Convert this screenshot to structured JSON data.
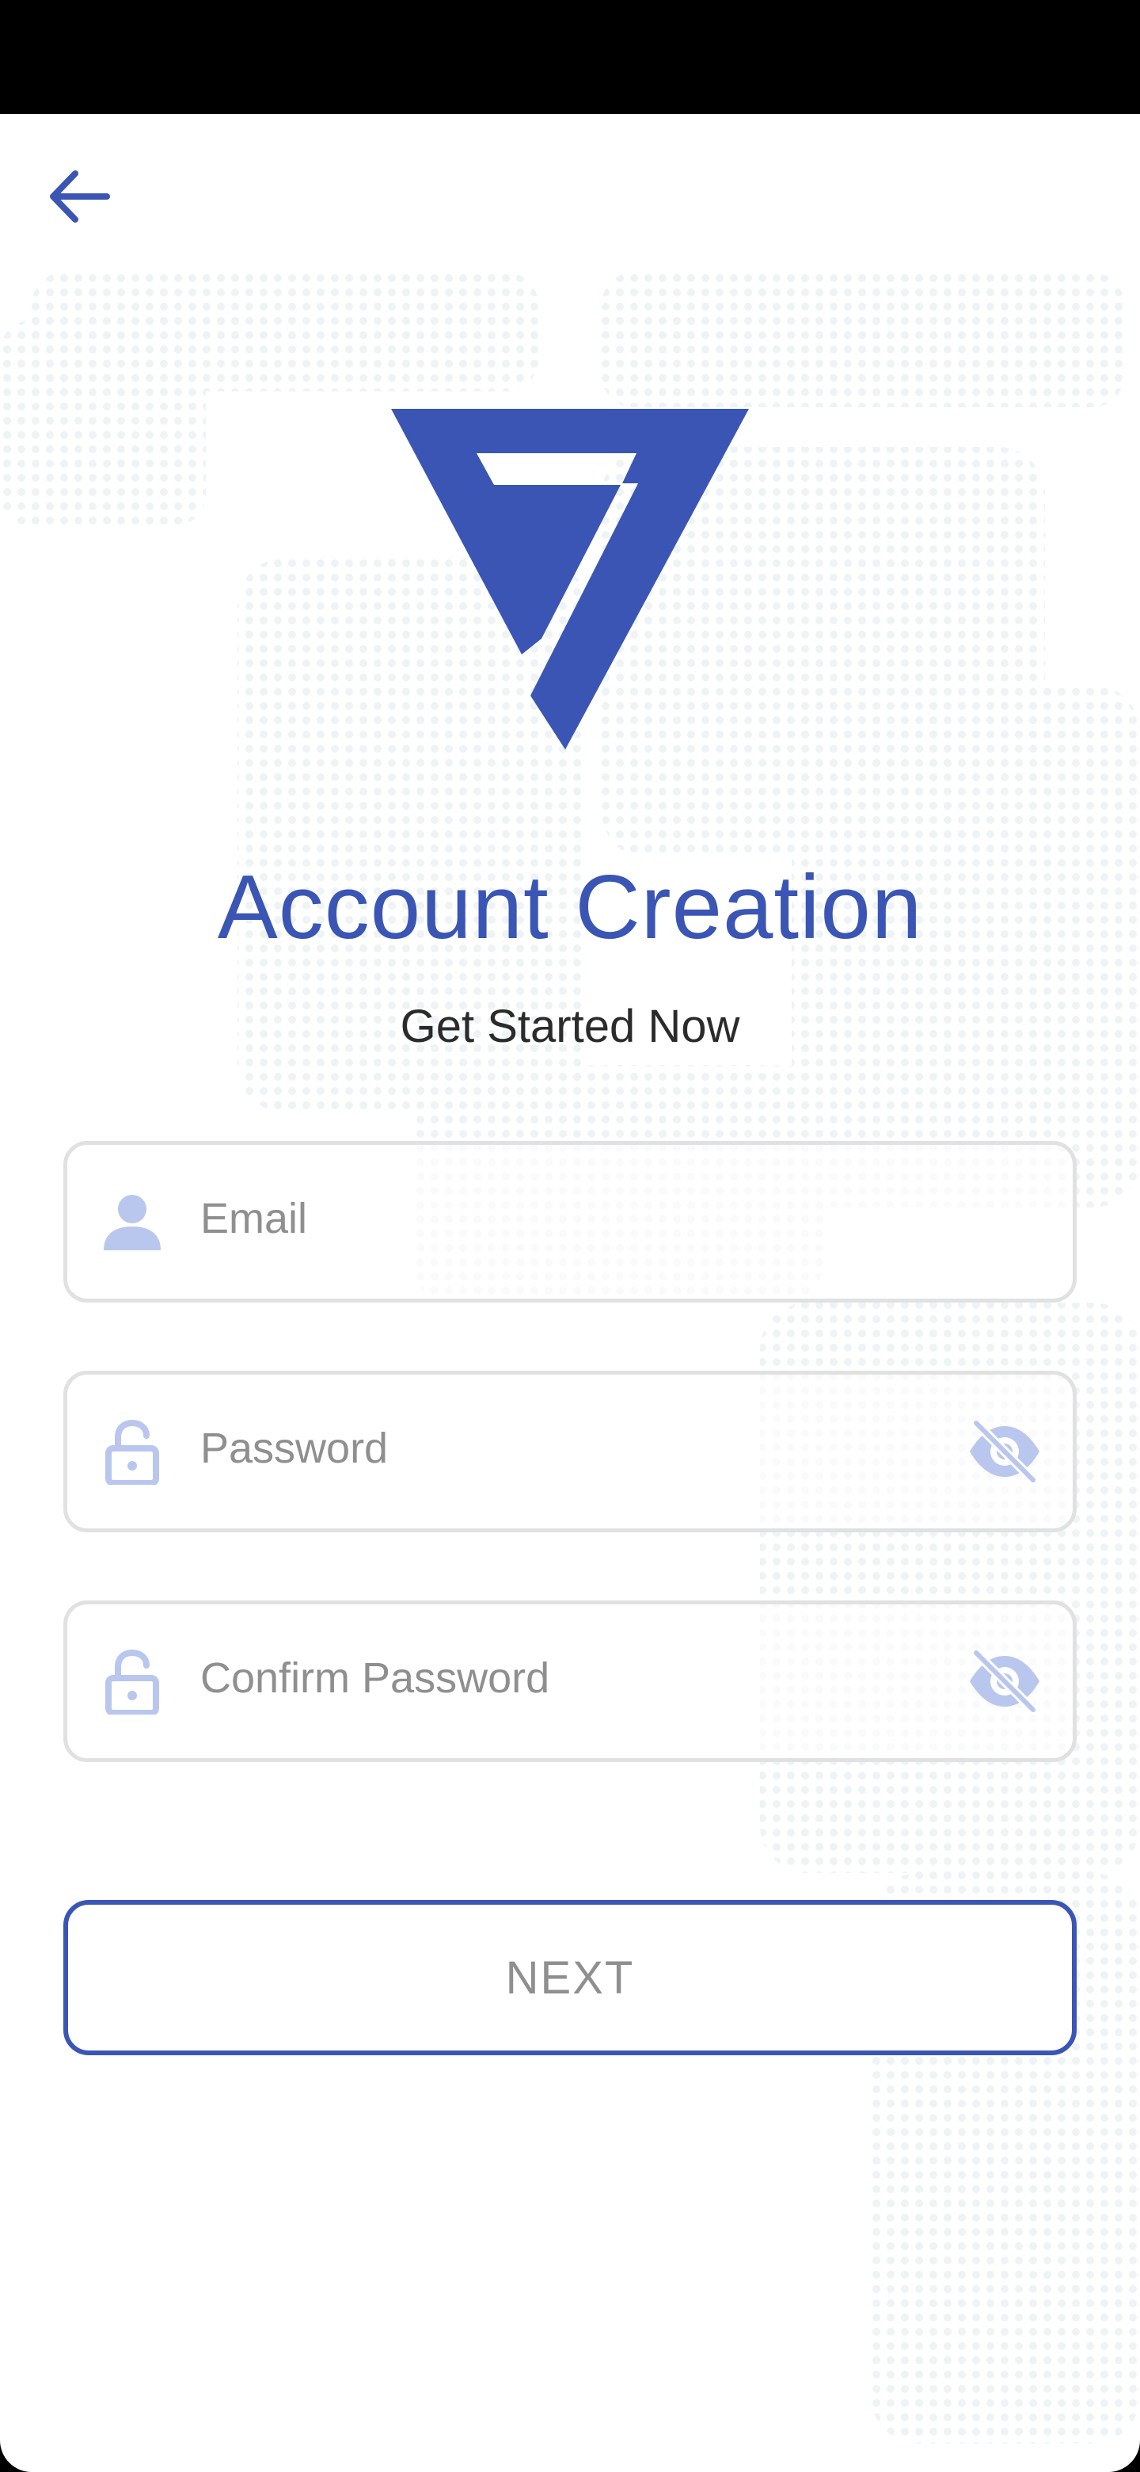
{
  "header": {
    "back_icon": "arrow-left-icon"
  },
  "brand": {
    "logo_icon": "triangle-seven-logo",
    "color": "#3a55b4"
  },
  "page": {
    "title": "Account Creation",
    "subtitle": "Get Started Now"
  },
  "form": {
    "email": {
      "placeholder": "Email",
      "value": "",
      "icon": "user-icon"
    },
    "password": {
      "placeholder": "Password",
      "value": "",
      "icon": "lock-icon",
      "toggle_icon": "eye-off-icon"
    },
    "confirm_password": {
      "placeholder": "Confirm Password",
      "value": "",
      "icon": "lock-icon",
      "toggle_icon": "eye-off-icon"
    }
  },
  "actions": {
    "next_label": "NEXT"
  },
  "colors": {
    "accent": "#3a55b4",
    "icon_light": "#b9c7ef",
    "field_border": "#e1e1e1",
    "placeholder": "#8f8f8f",
    "map_dots": "#eef3f6"
  }
}
